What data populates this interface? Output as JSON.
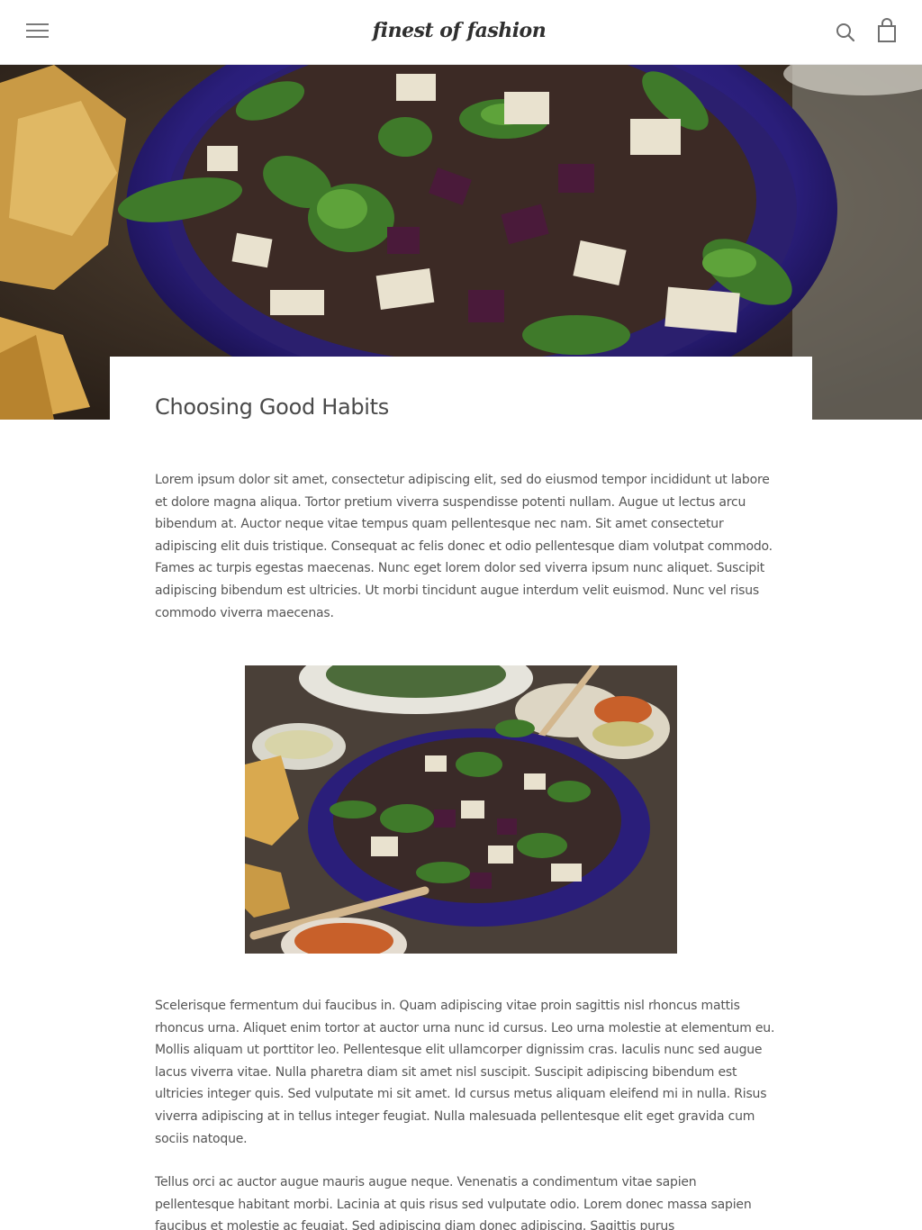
{
  "header": {
    "logo_text": "finest of fashion",
    "menu_icon": "hamburger-menu-icon",
    "search_icon": "search-icon",
    "cart_icon": "shopping-bag-icon"
  },
  "hero": {
    "image_description": "salad-bowl-photo"
  },
  "article": {
    "title": "Choosing Good Habits",
    "paragraphs": [
      "Lorem ipsum dolor sit amet, consectetur adipiscing elit, sed do eiusmod tempor incididunt ut labore et dolore magna aliqua. Tortor pretium viverra suspendisse potenti nullam. Augue ut lectus arcu bibendum at. Auctor neque vitae tempus quam pellentesque nec nam. Sit amet consectetur adipiscing elit duis tristique. Consequat ac felis donec et odio pellentesque diam volutpat commodo. Fames ac turpis egestas maecenas. Nunc eget lorem dolor sed viverra ipsum nunc aliquet. Suscipit adipiscing bibendum est ultricies. Ut morbi tincidunt augue interdum velit euismod. Nunc vel risus commodo viverra maecenas.",
      "Scelerisque fermentum dui faucibus in. Quam adipiscing vitae proin sagittis nisl rhoncus mattis rhoncus urna. Aliquet enim tortor at auctor urna nunc id cursus. Leo urna molestie at elementum eu. Mollis aliquam ut porttitor leo. Pellentesque elit ullamcorper dignissim cras. Iaculis nunc sed augue lacus viverra vitae. Nulla pharetra diam sit amet nisl suscipit. Suscipit adipiscing bibendum est ultricies integer quis. Sed vulputate mi sit amet. Id cursus metus aliquam eleifend mi in nulla. Risus viverra adipiscing at in tellus integer feugiat. Nulla malesuada pellentesque elit eget gravida cum sociis natoque.",
      "Tellus orci ac auctor augue mauris augue neque. Venenatis a condimentum vitae sapien pellentesque habitant morbi. Lacinia at quis risus sed vulputate odio. Lorem donec massa sapien faucibus et molestie ac feugiat. Sed adipiscing diam donec adipiscing. Sagittis purus"
    ]
  },
  "colors": {
    "bowl": "#2a1e7a",
    "greens": "#3f7a2a",
    "background": "#ffffff",
    "text": "#555555"
  }
}
